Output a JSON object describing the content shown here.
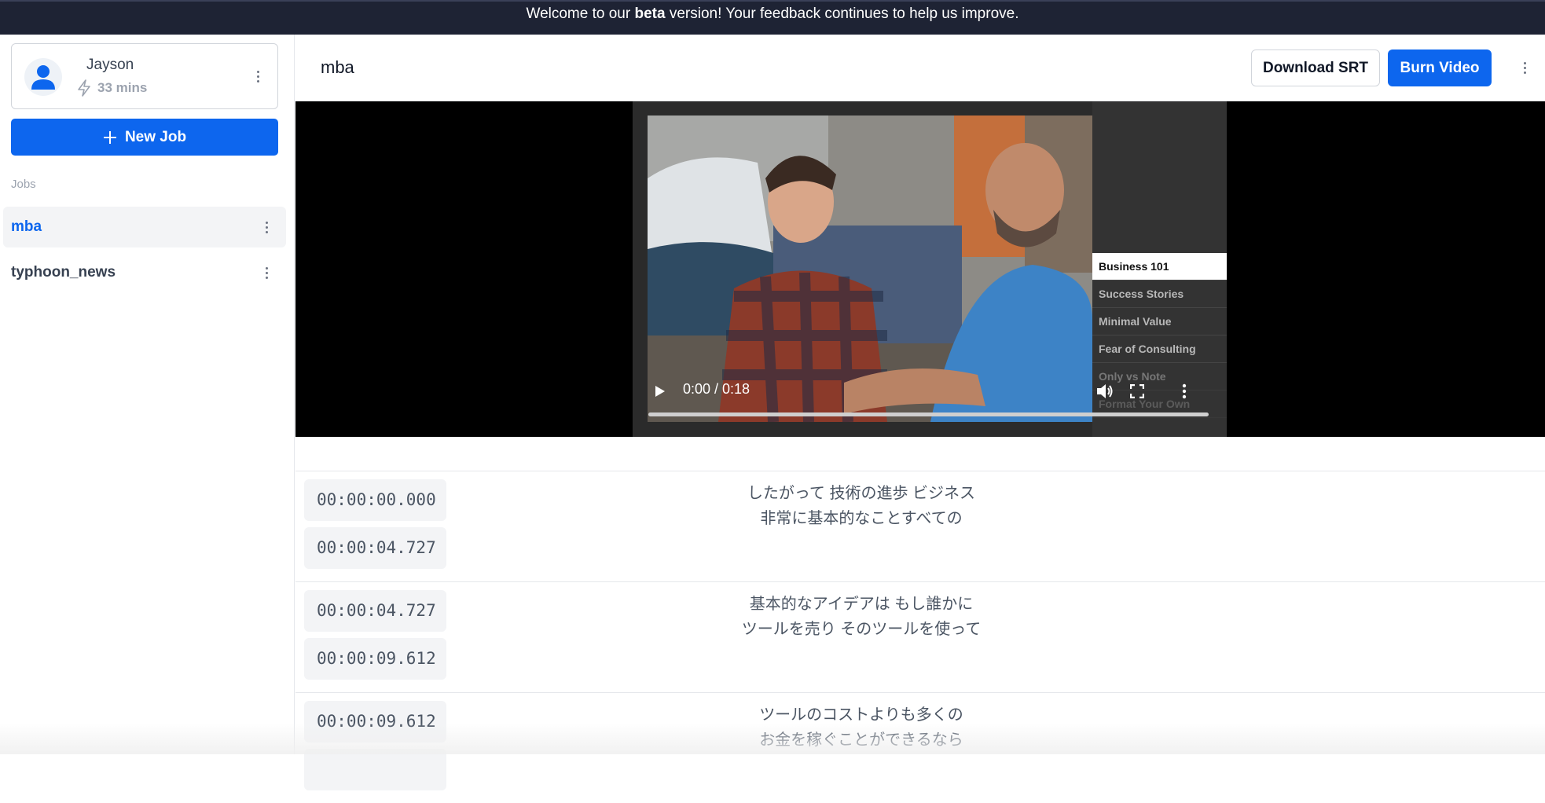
{
  "banner": {
    "prefix": "Welcome to our ",
    "bold": "beta",
    "suffix": " version! Your feedback continues to help us improve."
  },
  "user": {
    "name": "Jayson",
    "minutes": "33 mins"
  },
  "sidebar": {
    "new_job_label": "New Job",
    "jobs_label": "Jobs",
    "jobs": [
      {
        "label": "mba",
        "active": true
      },
      {
        "label": "typhoon_news",
        "active": false
      }
    ]
  },
  "header": {
    "title": "mba",
    "download_label": "Download SRT",
    "burn_label": "Burn Video"
  },
  "player": {
    "time": "0:00 / 0:18",
    "chapters": [
      "Business 101",
      "Success Stories",
      "Minimal Value",
      "Fear of Consulting",
      "Only vs Note",
      "Format Your Own"
    ]
  },
  "segments": [
    {
      "start": "00:00:00.000",
      "end": "00:00:04.727",
      "line1": "したがって 技術の進歩 ビジネス",
      "line2": "非常に基本的なことすべての"
    },
    {
      "start": "00:00:04.727",
      "end": "00:00:09.612",
      "line1": "基本的なアイデアは もし誰かに",
      "line2": "ツールを売り そのツールを使って"
    },
    {
      "start": "00:00:09.612",
      "end": "",
      "line1": "ツールのコストよりも多くの",
      "line2": "お金を稼ぐことができるなら"
    }
  ],
  "colors": {
    "accent": "#0d66ee",
    "banner_bg": "#1e2334"
  }
}
